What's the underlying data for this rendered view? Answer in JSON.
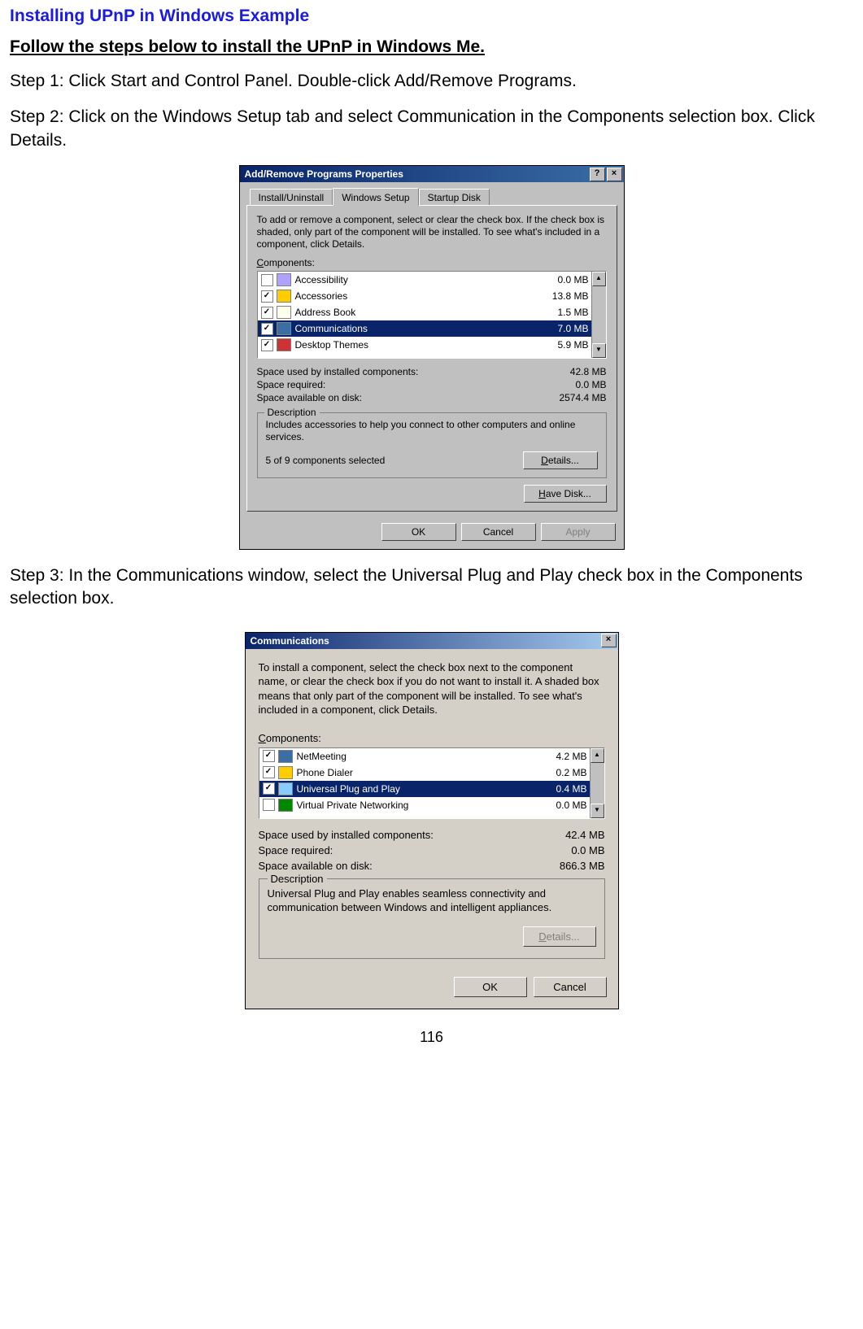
{
  "doc": {
    "title": "Installing UPnP in Windows Example",
    "subtitle": "Follow the steps below to install the UPnP in Windows Me.",
    "step1": "Step 1: Click Start and Control Panel. Double-click Add/Remove Programs.",
    "step2": "Step 2: Click on the Windows Setup tab and select Communication in the Components selection box. Click Details.",
    "step3": "Step 3: In the Communications window, select the Universal Plug and Play check box in the Components selection box.",
    "pagenum": "116"
  },
  "dlg1": {
    "title": "Add/Remove Programs Properties",
    "help": "?",
    "close": "×",
    "tabs": {
      "install": "Install/Uninstall",
      "setup": "Windows Setup",
      "disk": "Startup Disk"
    },
    "instr": "To add or remove a component, select or clear the check box. If the check box is shaded, only part of the component will be installed. To see what's included in a component, click Details.",
    "components_label_pre": "C",
    "components_label": "omponents:",
    "items": [
      {
        "checked": false,
        "name": "Accessibility",
        "size": "0.0 MB"
      },
      {
        "checked": true,
        "name": "Accessories",
        "size": "13.8 MB"
      },
      {
        "checked": true,
        "name": "Address Book",
        "size": "1.5 MB"
      },
      {
        "checked": true,
        "name": "Communications",
        "size": "7.0 MB",
        "selected": true
      },
      {
        "checked": true,
        "name": "Desktop Themes",
        "size": "5.9 MB"
      }
    ],
    "scroll_up": "▲",
    "scroll_down": "▼",
    "stats": {
      "used_l": "Space used by installed components:",
      "used_v": "42.8 MB",
      "req_l": "Space required:",
      "req_v": "0.0 MB",
      "avail_l": "Space available on disk:",
      "avail_v": "2574.4 MB"
    },
    "desc_title": "Description",
    "desc": "Includes accessories to help you connect to other computers and online services.",
    "selinfo": "5 of 9 components selected",
    "details_pre": "D",
    "details": "etails...",
    "havedisk_pre": "H",
    "havedisk": "ave Disk...",
    "ok": "OK",
    "cancel": "Cancel",
    "apply": "Apply"
  },
  "dlg2": {
    "title": "Communications",
    "close": "×",
    "instr": "To install a component, select the check box next to the component name, or clear the check box if you do not want to install it. A shaded box means that only part of the component will be installed. To see what's included in a component, click Details.",
    "components_label_pre": "C",
    "components_label": "omponents:",
    "items": [
      {
        "checked": true,
        "name": "NetMeeting",
        "size": "4.2 MB"
      },
      {
        "checked": true,
        "name": "Phone Dialer",
        "size": "0.2 MB"
      },
      {
        "checked": true,
        "name": "Universal Plug and Play",
        "size": "0.4 MB",
        "selected": true
      },
      {
        "checked": false,
        "name": "Virtual Private Networking",
        "size": "0.0 MB"
      }
    ],
    "scroll_up": "▲",
    "scroll_down": "▼",
    "stats": {
      "used_l": "Space used by installed components:",
      "used_v": "42.4 MB",
      "req_l": "Space required:",
      "req_v": "0.0 MB",
      "avail_l": "Space available on disk:",
      "avail_v": "866.3 MB"
    },
    "desc_title": "Description",
    "desc": "Universal Plug and Play enables seamless connectivity and communication between Windows and intelligent appliances.",
    "details_pre": "D",
    "details": "etails...",
    "ok": "OK",
    "cancel": "Cancel"
  }
}
